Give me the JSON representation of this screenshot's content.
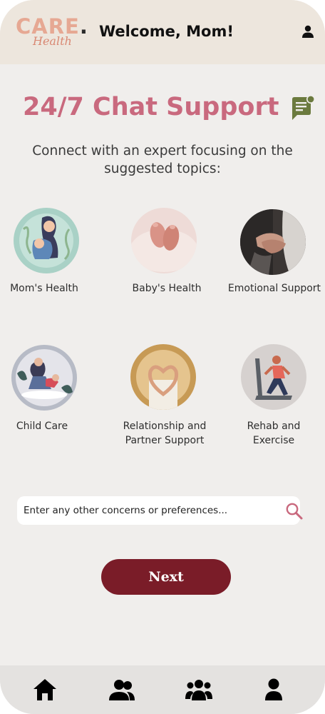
{
  "header": {
    "logo_main": "CARE",
    "logo_dot": ".",
    "logo_sub": "Health",
    "welcome": "Welcome, Mom!",
    "profile_icon": "profile-icon"
  },
  "main": {
    "title": "24/7 Chat Support",
    "chat_icon": "chat-icon",
    "subtitle": "Connect with an expert focusing on the suggested topics:"
  },
  "topics": [
    {
      "id": "moms-health",
      "label": "Mom's Health"
    },
    {
      "id": "babys-health",
      "label": "Baby's Health"
    },
    {
      "id": "emotional-support",
      "label": "Emotional Support"
    },
    {
      "id": "child-care",
      "label": "Child Care"
    },
    {
      "id": "relationship",
      "label": "Relationship and Partner Support"
    },
    {
      "id": "rehab",
      "label": "Rehab and Exercise"
    }
  ],
  "search": {
    "placeholder": "Enter any other concerns or preferences...",
    "value": ""
  },
  "next_label": "Next",
  "bottom_nav": [
    {
      "name": "home",
      "icon": "home-icon"
    },
    {
      "name": "community",
      "icon": "group-icon"
    },
    {
      "name": "groups",
      "icon": "people-icon"
    },
    {
      "name": "profile",
      "icon": "profile-icon"
    }
  ],
  "colors": {
    "accent_pink": "#c9697e",
    "button_maroon": "#7a1c28",
    "header_bg": "#ede6dd",
    "page_bg": "#f0eeec",
    "chat_icon_green": "#6b7a3e"
  }
}
